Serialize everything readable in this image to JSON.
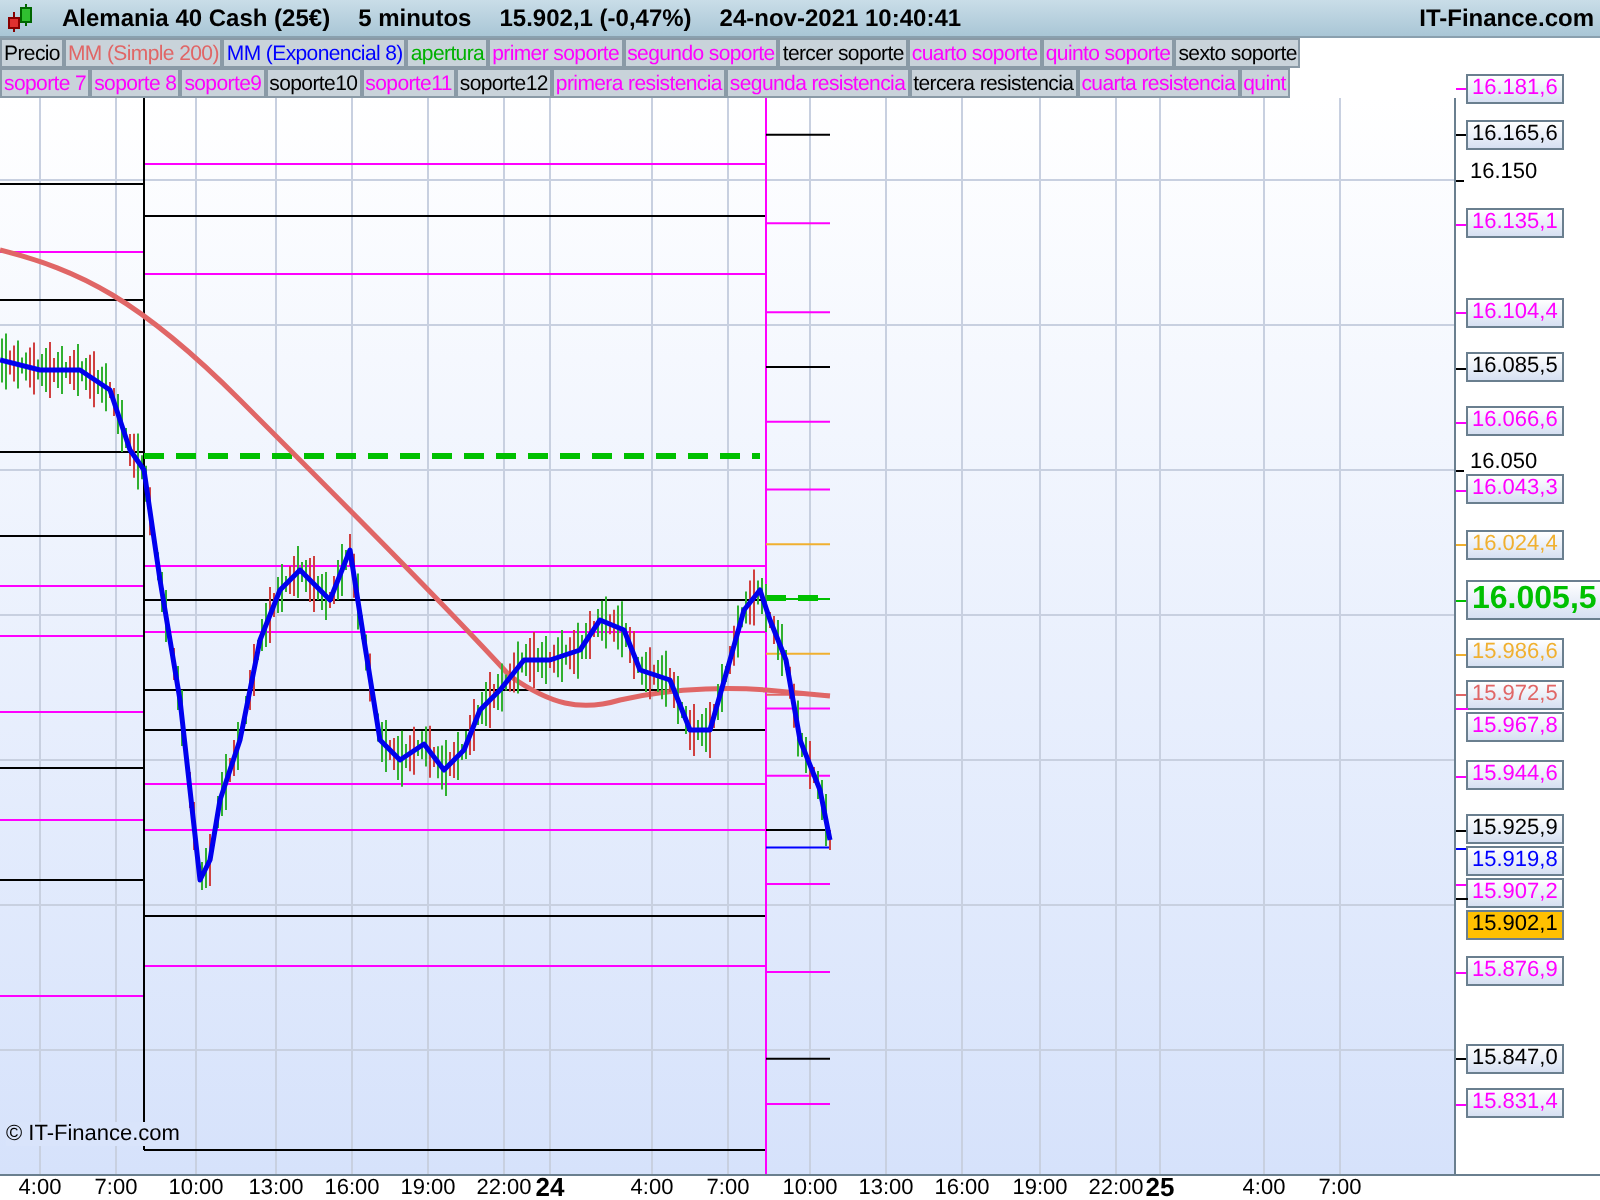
{
  "header": {
    "instrument": "Alemania 40 Cash (25€)",
    "interval": "5 minutos",
    "quote": "15.902,1 (-0,47%)",
    "timestamp": "24-nov-2021 10:40:41",
    "brand": "IT-Finance.com"
  },
  "legend_rows": [
    [
      {
        "label": "Precio",
        "color": "#000000"
      },
      {
        "label": "MM (Simple 200)",
        "color": "#e06666"
      },
      {
        "label": "MM (Exponencial 8)",
        "color": "#0000ff"
      },
      {
        "label": "apertura",
        "color": "#00b000"
      },
      {
        "label": "primer soporte",
        "color": "#ff00ff"
      },
      {
        "label": "segundo soporte",
        "color": "#ff00ff"
      },
      {
        "label": "tercer soporte",
        "color": "#000000"
      },
      {
        "label": "cuarto soporte",
        "color": "#ff00ff"
      },
      {
        "label": "quinto soporte",
        "color": "#ff00ff"
      },
      {
        "label": "sexto soporte",
        "color": "#000000"
      }
    ],
    [
      {
        "label": "soporte 7",
        "color": "#ff00ff"
      },
      {
        "label": "soporte 8",
        "color": "#ff00ff"
      },
      {
        "label": "soporte9",
        "color": "#ff00ff"
      },
      {
        "label": "soporte10",
        "color": "#000000"
      },
      {
        "label": "soporte11",
        "color": "#ff00ff"
      },
      {
        "label": "soporte12",
        "color": "#000000"
      },
      {
        "label": "primera resistencia",
        "color": "#ff00ff"
      },
      {
        "label": "segunda resistencia",
        "color": "#ff00ff"
      },
      {
        "label": "tercera resistencia",
        "color": "#000000"
      },
      {
        "label": "cuarta resistencia",
        "color": "#ff00ff"
      },
      {
        "label": "quint",
        "color": "#ff00ff"
      }
    ]
  ],
  "price_axis": {
    "ticks": [
      "16.150",
      "16.050"
    ]
  },
  "price_tags": [
    {
      "value": "16.181,6",
      "color": "#ff00ff",
      "kind": "level"
    },
    {
      "value": "16.165,6",
      "color": "#000000",
      "kind": "level"
    },
    {
      "value": "16.135,1",
      "color": "#ff00ff",
      "kind": "level"
    },
    {
      "value": "16.104,4",
      "color": "#ff00ff",
      "kind": "level"
    },
    {
      "value": "16.085,5",
      "color": "#000000",
      "kind": "level"
    },
    {
      "value": "16.066,6",
      "color": "#ff00ff",
      "kind": "level"
    },
    {
      "value": "16.043,3",
      "color": "#ff00ff",
      "kind": "level"
    },
    {
      "value": "16.024,4",
      "color": "#f0b030",
      "kind": "level"
    },
    {
      "value": "16.005,5",
      "color": "#00c000",
      "kind": "open"
    },
    {
      "value": "15.986,6",
      "color": "#f0b030",
      "kind": "level"
    },
    {
      "value": "15.972,5",
      "color": "#e06666",
      "kind": "level"
    },
    {
      "value": "15.967,8",
      "color": "#ff00ff",
      "kind": "level"
    },
    {
      "value": "15.944,6",
      "color": "#ff00ff",
      "kind": "level"
    },
    {
      "value": "15.925,9",
      "color": "#000000",
      "kind": "level"
    },
    {
      "value": "15.919,8",
      "color": "#0000ff",
      "kind": "level"
    },
    {
      "value": "15.907,2",
      "color": "#ff00ff",
      "kind": "level"
    },
    {
      "value": "15.902,1",
      "color": "#ffc000",
      "kind": "current"
    },
    {
      "value": "15.876,9",
      "color": "#ff00ff",
      "kind": "level"
    },
    {
      "value": "15.847,0",
      "color": "#000000",
      "kind": "level"
    },
    {
      "value": "15.831,4",
      "color": "#ff00ff",
      "kind": "level"
    }
  ],
  "time_axis": [
    {
      "label": "4:00",
      "kind": "time"
    },
    {
      "label": "7:00",
      "kind": "time"
    },
    {
      "label": "10:00",
      "kind": "time"
    },
    {
      "label": "13:00",
      "kind": "time"
    },
    {
      "label": "16:00",
      "kind": "time"
    },
    {
      "label": "19:00",
      "kind": "time"
    },
    {
      "label": "22:00",
      "kind": "time"
    },
    {
      "label": "24",
      "kind": "day"
    },
    {
      "label": "4:00",
      "kind": "time"
    },
    {
      "label": "7:00",
      "kind": "time"
    },
    {
      "label": "10:00",
      "kind": "time"
    },
    {
      "label": "13:00",
      "kind": "time"
    },
    {
      "label": "16:00",
      "kind": "time"
    },
    {
      "label": "19:00",
      "kind": "time"
    },
    {
      "label": "22:00",
      "kind": "time"
    },
    {
      "label": "25",
      "kind": "day"
    },
    {
      "label": "4:00",
      "kind": "time"
    },
    {
      "label": "7:00",
      "kind": "time"
    }
  ],
  "copyright": "© IT-Finance.com"
}
